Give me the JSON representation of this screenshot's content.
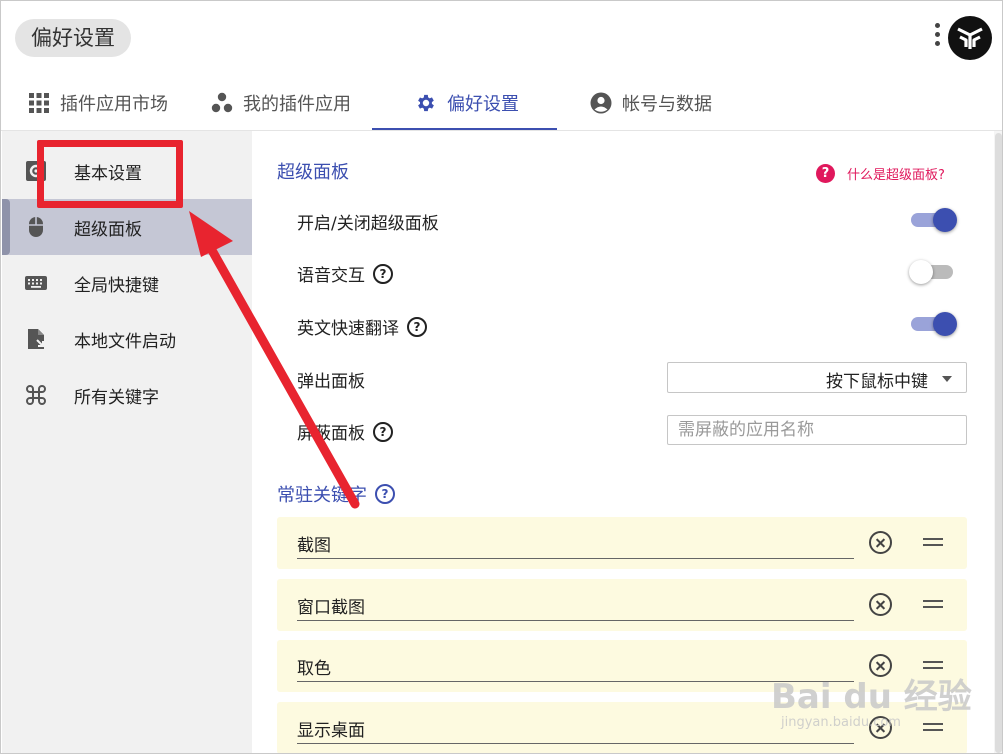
{
  "header": {
    "title": "偏好设置"
  },
  "tabs": [
    {
      "label": "插件应用市场",
      "icon": "grid-icon"
    },
    {
      "label": "我的插件应用",
      "icon": "dots-group-icon"
    },
    {
      "label": "偏好设置",
      "icon": "gear-icon",
      "active": true
    },
    {
      "label": "帐号与数据",
      "icon": "account-circle-icon"
    }
  ],
  "sidebar": {
    "items": [
      {
        "label": "基本设置",
        "icon": "settings-box-icon"
      },
      {
        "label": "超级面板",
        "icon": "mouse-icon",
        "active": true
      },
      {
        "label": "全局快捷键",
        "icon": "keyboard-icon"
      },
      {
        "label": "本地文件启动",
        "icon": "file-launch-icon"
      },
      {
        "label": "所有关键字",
        "icon": "command-icon"
      }
    ]
  },
  "main": {
    "section_title": "超级面板",
    "help_link": "什么是超级面板?",
    "rows": {
      "toggle_panel": {
        "label": "开启/关闭超级面板",
        "on": true
      },
      "voice": {
        "label": "语音交互",
        "on": false
      },
      "translate": {
        "label": "英文快速翻译",
        "on": true
      },
      "popup": {
        "label": "弹出面板",
        "value": "按下鼠标中键"
      },
      "block": {
        "label": "屏蔽面板",
        "placeholder": "需屏蔽的应用名称"
      }
    },
    "keywords_title": "常驻关键字",
    "keywords": [
      "截图",
      "窗口截图",
      "取色",
      "显示桌面"
    ]
  },
  "watermark": {
    "line1": "Bai du 经验",
    "line2": "jingyan.baidu.com"
  },
  "colors": {
    "accent": "#3c4fb0",
    "help": "#e0185c",
    "annotation": "#e8242f",
    "keyword_bg": "#fdfae0"
  }
}
